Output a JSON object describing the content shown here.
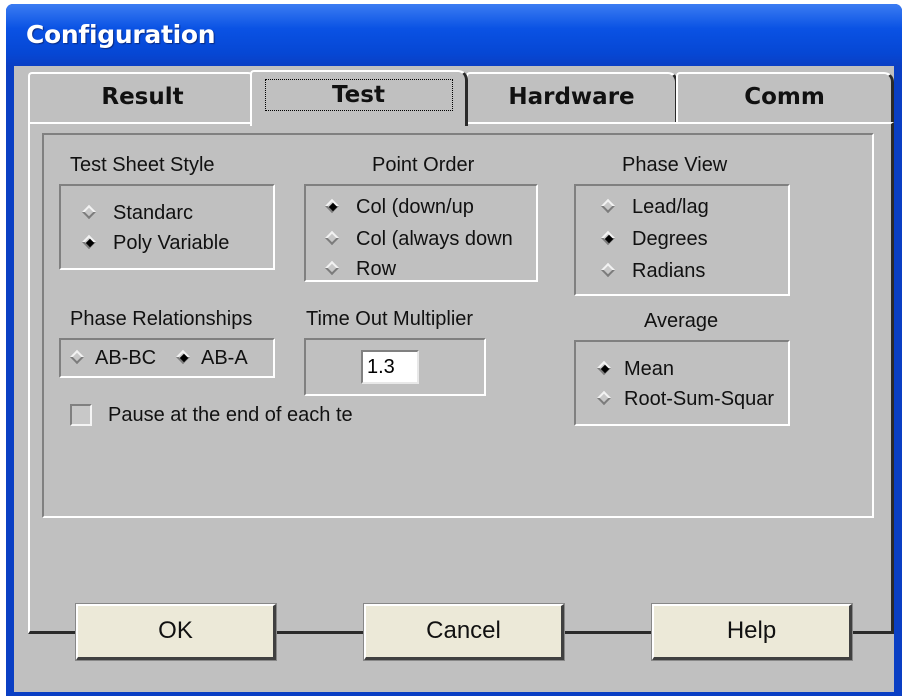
{
  "window": {
    "title": "Configuration"
  },
  "tabs": [
    {
      "label": "Result",
      "active": false
    },
    {
      "label": "Test",
      "active": true
    },
    {
      "label": "Hardware",
      "active": false
    },
    {
      "label": "Comm",
      "active": false
    }
  ],
  "test_sheet_style": {
    "label": "Test Sheet Style",
    "options": [
      {
        "label": "Standarc",
        "selected": false
      },
      {
        "label": "Poly Variable",
        "selected": true
      }
    ]
  },
  "point_order": {
    "label": "Point Order",
    "options": [
      {
        "label": "Col (down/up",
        "selected": true
      },
      {
        "label": "Col (always down",
        "selected": false
      },
      {
        "label": "Row",
        "selected": false
      }
    ]
  },
  "phase_view": {
    "label": "Phase View",
    "options": [
      {
        "label": "Lead/lag",
        "selected": false
      },
      {
        "label": "Degrees",
        "selected": true
      },
      {
        "label": "Radians",
        "selected": false
      }
    ]
  },
  "phase_relationships": {
    "label": "Phase Relationships",
    "options": [
      {
        "label": "AB-BC",
        "selected": false
      },
      {
        "label": "AB-A",
        "selected": true
      }
    ]
  },
  "time_out_multiplier": {
    "label": "Time Out Multiplier",
    "value": "1.3"
  },
  "average": {
    "label": "Average",
    "options": [
      {
        "label": "Mean",
        "selected": true
      },
      {
        "label": "Root-Sum-Squar",
        "selected": false
      }
    ]
  },
  "pause_checkbox": {
    "label": "Pause at the end of each te",
    "checked": false
  },
  "buttons": {
    "ok": "OK",
    "cancel": "Cancel",
    "help": "Help"
  },
  "colors": {
    "titlebar": "#0a52e4",
    "face": "#c0c0c0",
    "button_face": "#ece9d8"
  }
}
